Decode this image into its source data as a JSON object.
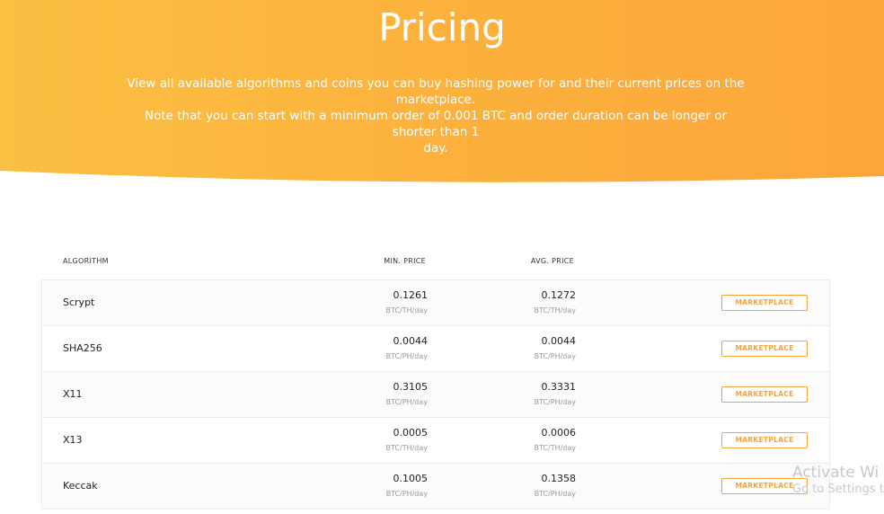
{
  "hero": {
    "title": "Pricing",
    "description_line1": "View all available algorithms and coins you can buy hashing power for and their current prices on the marketplace.",
    "description_line2": "Note that you can start with a minimum order of 0.001 BTC and order duration can be longer or shorter than 1",
    "description_line3": "day."
  },
  "table": {
    "headers": {
      "algorithm": "ALGORITHM",
      "min_price": "MIN. PRICE",
      "avg_price": "AVG. PRICE"
    },
    "rows": [
      {
        "algorithm": "Scrypt",
        "min_price": "0.1261",
        "min_unit": "BTC/TH/day",
        "avg_price": "0.1272",
        "avg_unit": "BTC/TH/day",
        "button": "MARKETPLACE"
      },
      {
        "algorithm": "SHA256",
        "min_price": "0.0044",
        "min_unit": "BTC/PH/day",
        "avg_price": "0.0044",
        "avg_unit": "BTC/PH/day",
        "button": "MARKETPLACE"
      },
      {
        "algorithm": "X11",
        "min_price": "0.3105",
        "min_unit": "BTC/PH/day",
        "avg_price": "0.3331",
        "avg_unit": "BTC/PH/day",
        "button": "MARKETPLACE"
      },
      {
        "algorithm": "X13",
        "min_price": "0.0005",
        "min_unit": "BTC/TH/day",
        "avg_price": "0.0006",
        "avg_unit": "BTC/TH/day",
        "button": "MARKETPLACE"
      },
      {
        "algorithm": "Keccak",
        "min_price": "0.1005",
        "min_unit": "BTC/PH/day",
        "avg_price": "0.1358",
        "avg_unit": "BTC/PH/day",
        "button": "MARKETPLACE"
      }
    ]
  },
  "watermark": {
    "title": "Activate Wi",
    "subtitle": "Go to Settings t"
  },
  "colors": {
    "hero_start": "#fbbf42",
    "hero_end": "#fca63c",
    "accent": "#f6a23a"
  }
}
